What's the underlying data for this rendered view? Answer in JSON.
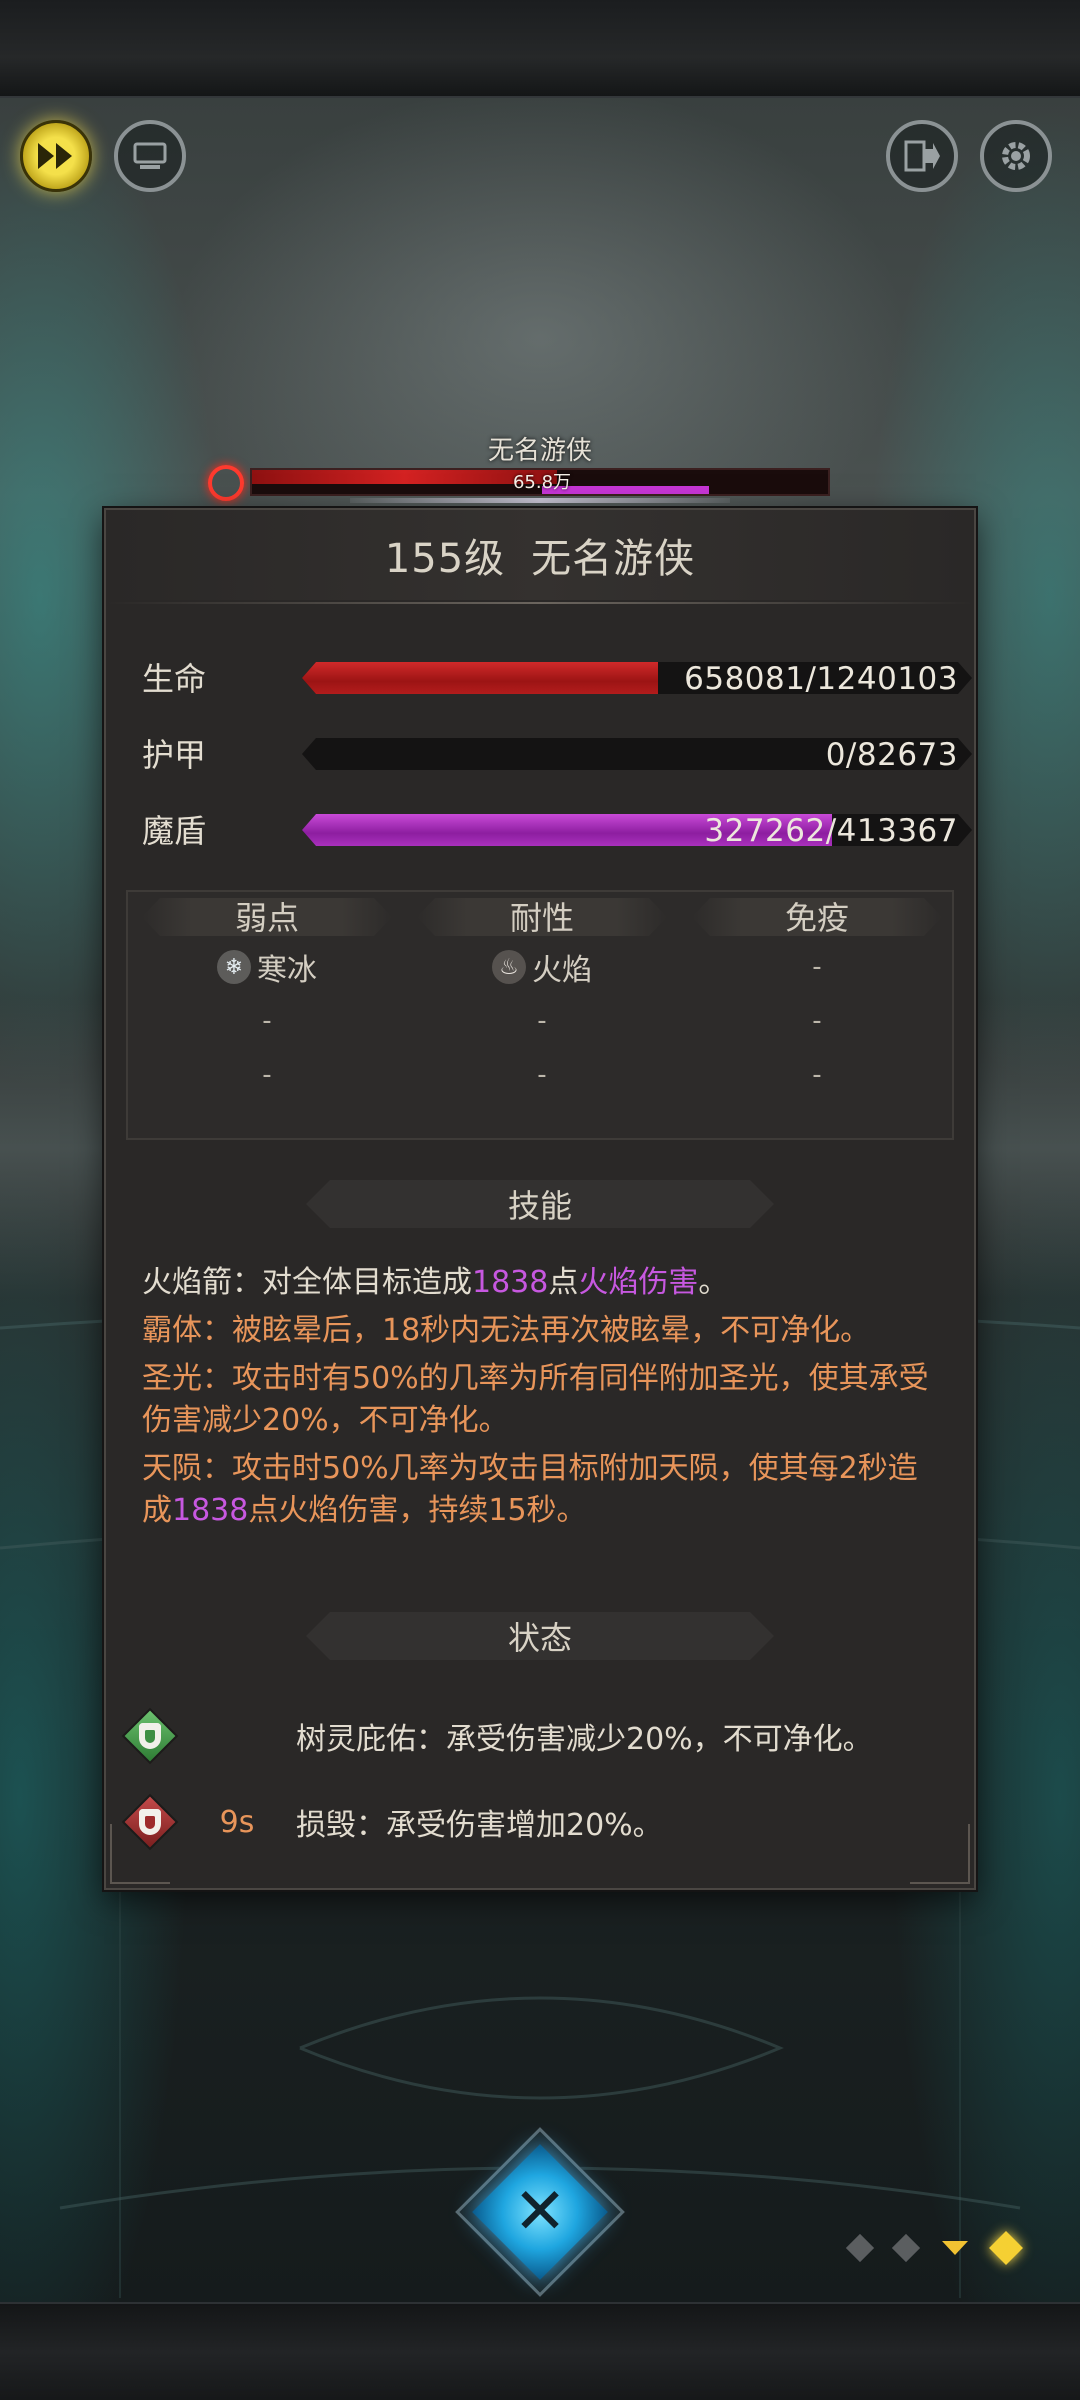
{
  "hud": {
    "fast_forward_icon": "fast-forward-icon",
    "auto_icon": "auto-battle-icon",
    "exit_icon": "exit-icon",
    "settings_icon": "gear-icon"
  },
  "boss": {
    "name": "无名游侠",
    "hp_label": "65.8万",
    "hp_fraction": 0.53,
    "shield_fraction": 0.79,
    "colors": {
      "hp": "#d42222",
      "shield": "#c736d6"
    }
  },
  "panel": {
    "level": "155级",
    "name": "无名游侠",
    "stats": [
      {
        "label": "生命",
        "value": "658081/1240103",
        "current": 658081,
        "max": 1240103,
        "type": "hp"
      },
      {
        "label": "护甲",
        "value": "0/82673",
        "current": 0,
        "max": 82673,
        "type": "armor"
      },
      {
        "label": "魔盾",
        "value": "327262/413367",
        "current": 327262,
        "max": 413367,
        "type": "mp"
      }
    ],
    "resistances": {
      "headers": [
        "弱点",
        "耐性",
        "免疫"
      ],
      "weakness": [
        "寒冰",
        "-",
        "-"
      ],
      "resistance": [
        "火焰",
        "-",
        "-"
      ],
      "immunity": [
        "-",
        "-",
        "-"
      ],
      "weakness_icon": "snowflake-icon",
      "resistance_icon": "flame-icon"
    },
    "skills_header": "技能",
    "skills": [
      {
        "parts": [
          {
            "t": "火焰箭：对全体目标造成",
            "c": "white"
          },
          {
            "t": "1838",
            "c": "purple"
          },
          {
            "t": "点",
            "c": "white"
          },
          {
            "t": "火焰伤害",
            "c": "purple"
          },
          {
            "t": "。",
            "c": "white"
          }
        ]
      },
      {
        "parts": [
          {
            "t": "霸体：被眩晕后，18秒内无法再次被眩晕，不可净化。",
            "c": "orange"
          }
        ]
      },
      {
        "parts": [
          {
            "t": "圣光：攻击时有50%的几率为所有同伴附加圣光，使其承受伤害减少20%，不可净化。",
            "c": "orange"
          }
        ]
      },
      {
        "parts": [
          {
            "t": "天陨：攻击时50%几率为攻击目标附加天陨，使其每2秒造成",
            "c": "orange"
          },
          {
            "t": "1838",
            "c": "purple"
          },
          {
            "t": "点火焰伤害，持续15秒。",
            "c": "orange"
          }
        ]
      }
    ],
    "status_header": "状态",
    "statuses": [
      {
        "kind": "buff",
        "timer": "",
        "text": "树灵庇佑：承受伤害减少20%，不可净化。",
        "icon": "green-shield-icon"
      },
      {
        "kind": "debuff",
        "timer": "9s",
        "text": "损毁：承受伤害增加20%。",
        "icon": "red-shield-icon"
      }
    ]
  },
  "bottom": {
    "close_icon": "crossed-swords-icon",
    "pages": 4,
    "active_page": 4
  }
}
